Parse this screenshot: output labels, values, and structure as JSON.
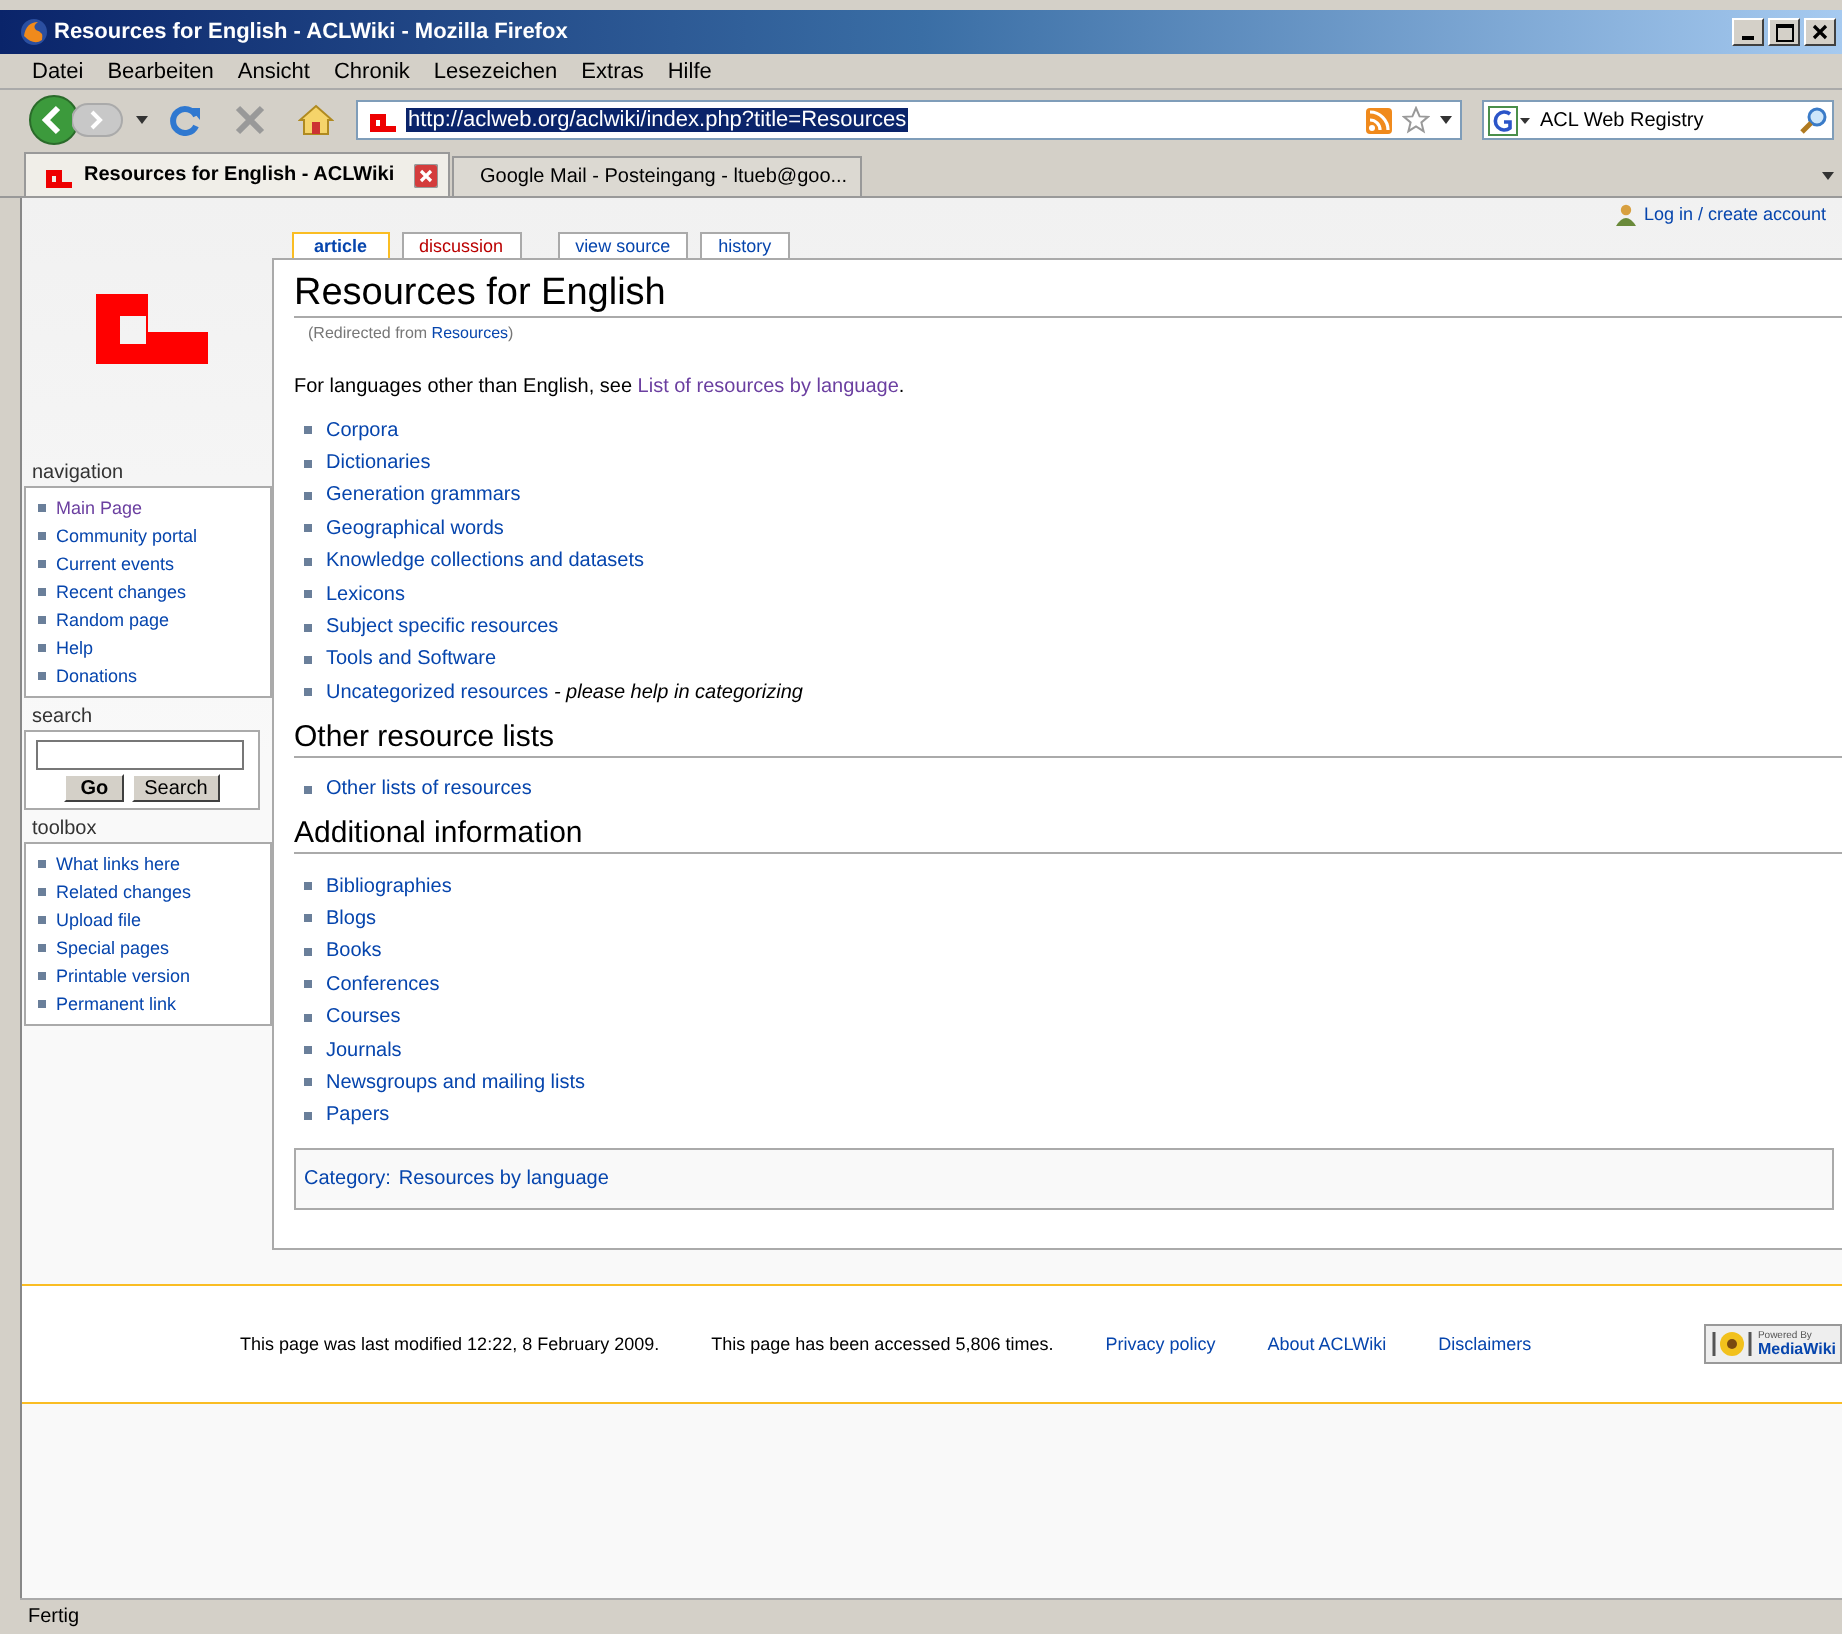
{
  "window": {
    "title": "Resources for English - ACLWiki - Mozilla Firefox"
  },
  "menu": [
    "Datei",
    "Bearbeiten",
    "Ansicht",
    "Chronik",
    "Lesezeichen",
    "Extras",
    "Hilfe"
  ],
  "address": {
    "value": "http://aclweb.org/aclwiki/index.php?title=Resources"
  },
  "search_engine": {
    "value": "ACL Web Registry"
  },
  "tabs": [
    {
      "label": "Resources for English - ACLWiki",
      "selected": true,
      "kind": "acl"
    },
    {
      "label": "Google Mail - Posteingang - ltueb@goo...",
      "selected": false,
      "kind": "mail"
    }
  ],
  "personal": {
    "label": "Log in / create account"
  },
  "sidebar": {
    "navigation": {
      "title": "navigation",
      "items": [
        {
          "label": "Main Page",
          "visited": true
        },
        {
          "label": "Community portal",
          "visited": false
        },
        {
          "label": "Current events",
          "visited": false
        },
        {
          "label": "Recent changes",
          "visited": false
        },
        {
          "label": "Random page",
          "visited": false
        },
        {
          "label": "Help",
          "visited": false
        },
        {
          "label": "Donations",
          "visited": false
        }
      ]
    },
    "search": {
      "title": "search",
      "buttons": [
        "Go",
        "Search"
      ]
    },
    "toolbox": {
      "title": "toolbox",
      "items": [
        "What links here",
        "Related changes",
        "Upload file",
        "Special pages",
        "Printable version",
        "Permanent link"
      ]
    }
  },
  "page_tabs": [
    {
      "label": "article",
      "selected": true,
      "missing": false
    },
    {
      "label": "discussion",
      "selected": false,
      "missing": true
    },
    {
      "label": "view source",
      "selected": false,
      "missing": false
    },
    {
      "label": "history",
      "selected": false,
      "missing": false
    }
  ],
  "article": {
    "title": "Resources for English",
    "redirect": {
      "prefix": "(Redirected from ",
      "link": "Resources",
      "suffix": ")"
    },
    "intro": {
      "text": "For languages other than English, see ",
      "link": "List of resources by language",
      "link_visited": true,
      "end": "."
    },
    "list": [
      {
        "link": "Corpora"
      },
      {
        "link": "Dictionaries"
      },
      {
        "link": "Generation grammars"
      },
      {
        "link": "Geographical words"
      },
      {
        "link": "Knowledge collections and datasets"
      },
      {
        "link": "Lexicons"
      },
      {
        "link": "Subject specific resources"
      },
      {
        "link": "Tools and Software"
      },
      {
        "link": "Uncategorized resources",
        "note": " - please help in categorizing"
      }
    ],
    "sections": [
      {
        "heading": "Other resource lists",
        "items": [
          "Other lists of resources"
        ]
      },
      {
        "heading": "Additional information",
        "items": [
          "Bibliographies",
          "Blogs",
          "Books",
          "Conferences",
          "Courses",
          "Journals",
          "Newsgroups and mailing lists",
          "Papers"
        ]
      }
    ],
    "category": {
      "label": "Category:",
      "link": "Resources by language"
    }
  },
  "footer": {
    "modified": "This page was last modified 12:22, 8 February 2009.",
    "accessed": "This page has been accessed 5,806 times.",
    "links": [
      "Privacy policy",
      "About ACLWiki",
      "Disclaimers"
    ],
    "badge": {
      "top": "Powered By",
      "bottom": "MediaWiki"
    }
  },
  "status_bar": {
    "text": "Fertig"
  }
}
